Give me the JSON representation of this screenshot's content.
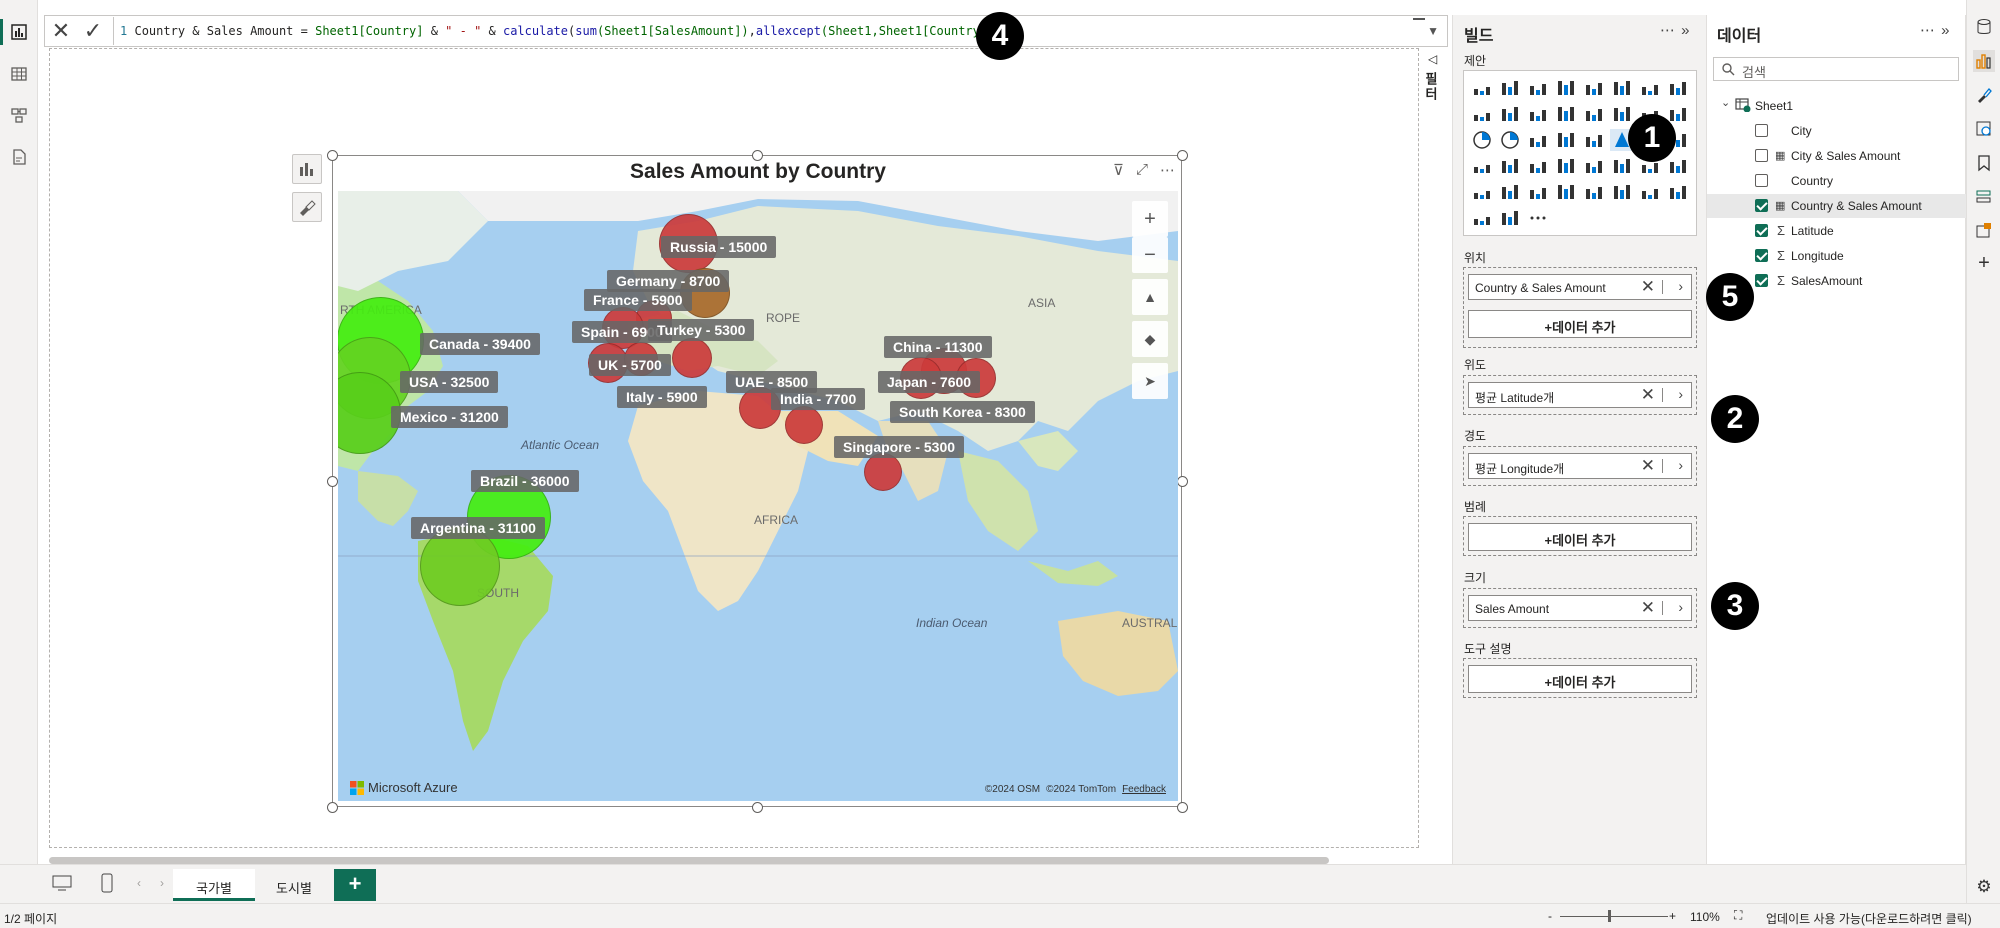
{
  "formula": {
    "line_number": "1",
    "measure_name": "Country & Sales Amount",
    "eq": " = ",
    "part_sheet1_country": "Sheet1[Country]",
    "part_amp1": " & ",
    "part_dash": "\" - \"",
    "part_amp2": " & ",
    "part_calculate": "calculate",
    "part_paren1": "(",
    "part_sum": "sum",
    "part_sum_arg": "(Sheet1[SalesAmount])",
    "part_comma": ",",
    "part_allexcept": "allexcept",
    "part_allexcept_args": "(Sheet1,Sheet1[Country])",
    "part_close": ")"
  },
  "visual": {
    "title": "Sales Amount by Country"
  },
  "map": {
    "region_labels": {
      "north_america": "RTH AMERICA",
      "asia": "ASIA",
      "europe": "ROPE",
      "africa": "AFRICA",
      "south_america": "SOUTH",
      "australia": "AUSTRAL",
      "atlantic": "Atlantic Ocean",
      "indian": "Indian Ocean"
    },
    "points": [
      {
        "label": "Canada - 39400",
        "value": 39400,
        "color": "#44ee10"
      },
      {
        "label": "USA - 32500",
        "value": 32500,
        "color": "#63d321"
      },
      {
        "label": "Mexico - 31200",
        "value": 31200,
        "color": "#58cf1a"
      },
      {
        "label": "Brazil - 36000",
        "value": 36000,
        "color": "#44ee10"
      },
      {
        "label": "Argentina - 31100",
        "value": 31100,
        "color": "#6fcc23"
      },
      {
        "label": "Russia - 15000",
        "value": 15000,
        "color": "#cc3b3b"
      },
      {
        "label": "Germany - 8700",
        "value": 8700,
        "color": "#a86a2a"
      },
      {
        "label": "France - 5900",
        "value": 5900,
        "color": "#cc3b3b"
      },
      {
        "label": "Spain - 6900",
        "value": 6900,
        "color": "#cc3b3b"
      },
      {
        "label": "Turkey - 5300",
        "value": 5300,
        "color": "#cc3b3b"
      },
      {
        "label": "UK - 5700",
        "value": 5700,
        "color": "#cc3b3b"
      },
      {
        "label": "Italy - 5900",
        "value": 5900,
        "color": "#cc3b3b"
      },
      {
        "label": "UAE - 8500",
        "value": 8500,
        "color": "#cc3b3b"
      },
      {
        "label": "India - 7700",
        "value": 7700,
        "color": "#cc3b3b"
      },
      {
        "label": "China - 11300",
        "value": 11300,
        "color": "#cc3b3b"
      },
      {
        "label": "Japan - 7600",
        "value": 7600,
        "color": "#cc3b3b"
      },
      {
        "label": "South Korea - 8300",
        "value": 8300,
        "color": "#cc3b3b"
      },
      {
        "label": "Singapore - 5300",
        "value": 5300,
        "color": "#cc3b3b"
      }
    ],
    "zoom_in": "+",
    "zoom_out": "−",
    "brand": "Microsoft Azure",
    "copyright_osm": "©2024 OSM",
    "copyright_tomtom": "©2024 TomTom",
    "feedback": "Feedback"
  },
  "filters_label": "필터",
  "build_panel": {
    "title": "빌드",
    "suggest_label": "제안",
    "location_label": "위치",
    "location_field": "Country & Sales Amount",
    "add_data": "+데이터 추가",
    "latitude_label": "위도",
    "latitude_field": "평균 Latitude개",
    "longitude_label": "경도",
    "longitude_field": "평균 Longitude개",
    "legend_label": "범례",
    "size_label": "크기",
    "size_field": "Sales Amount",
    "tooltip_label": "도구 설명"
  },
  "data_panel": {
    "title": "데이터",
    "search_placeholder": "검색",
    "table_name": "Sheet1",
    "fields": [
      {
        "name": "City",
        "checked": false,
        "type": "text"
      },
      {
        "name": "City & Sales Amount",
        "checked": false,
        "type": "measure"
      },
      {
        "name": "Country",
        "checked": false,
        "type": "text"
      },
      {
        "name": "Country & Sales Amount",
        "checked": true,
        "type": "measure"
      },
      {
        "name": "Latitude",
        "checked": true,
        "type": "sum"
      },
      {
        "name": "Longitude",
        "checked": true,
        "type": "sum"
      },
      {
        "name": "SalesAmount",
        "checked": true,
        "type": "sum"
      }
    ]
  },
  "callouts": [
    "1",
    "2",
    "3",
    "4",
    "5"
  ],
  "pages": {
    "tab1": "국가별",
    "tab2": "도시별",
    "add": "+"
  },
  "status": {
    "page": "1/2 페이지",
    "zoom": "110%",
    "zoom_minus": "-",
    "zoom_plus": "+",
    "update": "업데이트 사용 가능(다운로드하려면 클릭)"
  },
  "colors": {
    "accent": "#0f6e56",
    "positive": "#44ee10",
    "negative": "#cc3b3b"
  }
}
